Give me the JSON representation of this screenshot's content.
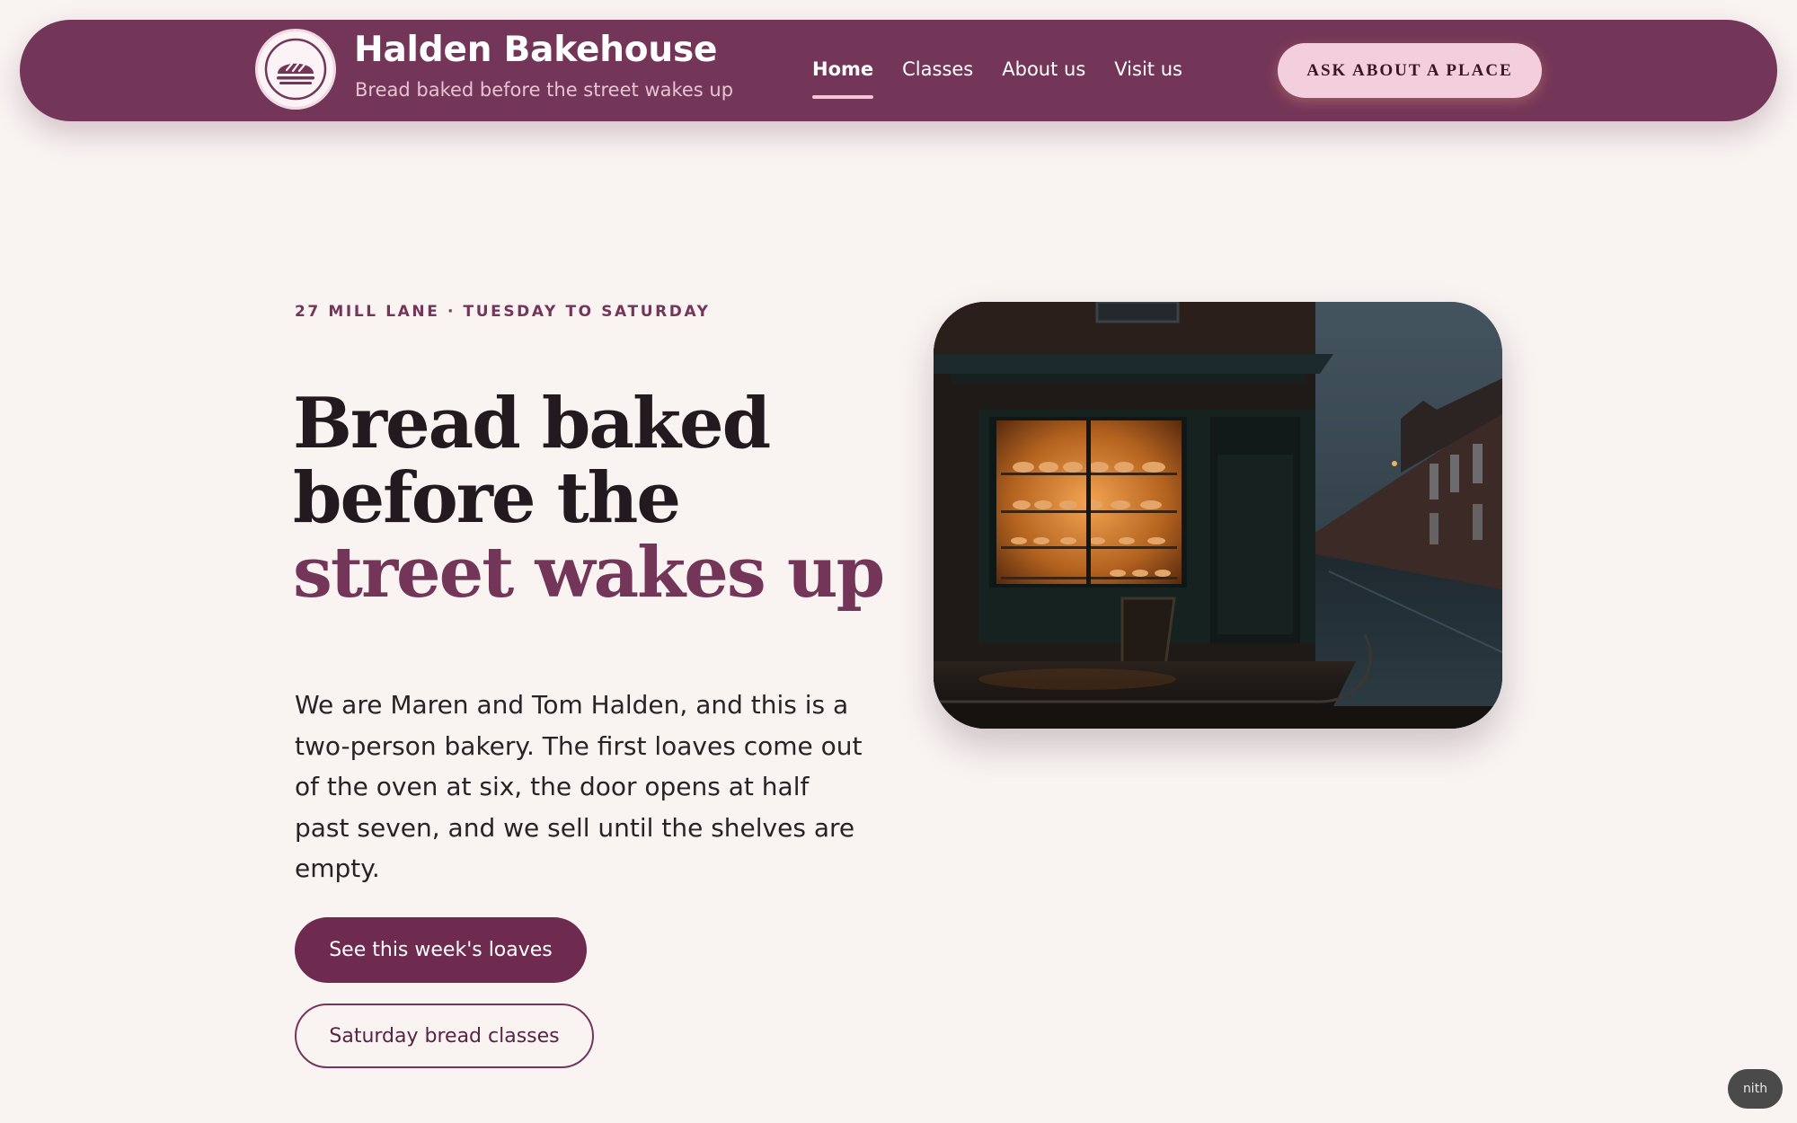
{
  "header": {
    "brand_name": "Halden Bakehouse",
    "tagline": "Bread baked before the street wakes up",
    "logo_icon": "bread-loaf-icon",
    "nav": [
      {
        "label": "Home",
        "active": true
      },
      {
        "label": "Classes",
        "active": false
      },
      {
        "label": "About us",
        "active": false
      },
      {
        "label": "Visit us",
        "active": false
      }
    ],
    "cta_label": "ASK ABOUT A PLACE"
  },
  "hero": {
    "eyebrow": "27 MILL LANE · TUESDAY TO SATURDAY",
    "headline": {
      "line1": "Bread baked",
      "line2": "before the",
      "line3": "street wakes up"
    },
    "intro": "We are Maren and Tom Halden, and this is a two-person bakery. The first loaves come out of the oven at six, the door opens at half past seven, and we sell until the shelves are empty.",
    "primary_button": "See this week's loaves",
    "secondary_button": "Saturday bread classes"
  },
  "corner_chip": "nith",
  "colors": {
    "brand_plum": "#743658",
    "primary_button": "#6e2a4f",
    "cta_pink": "#f3cfdd",
    "page_background": "#f9f3f2",
    "text_dark": "#221a1e"
  }
}
